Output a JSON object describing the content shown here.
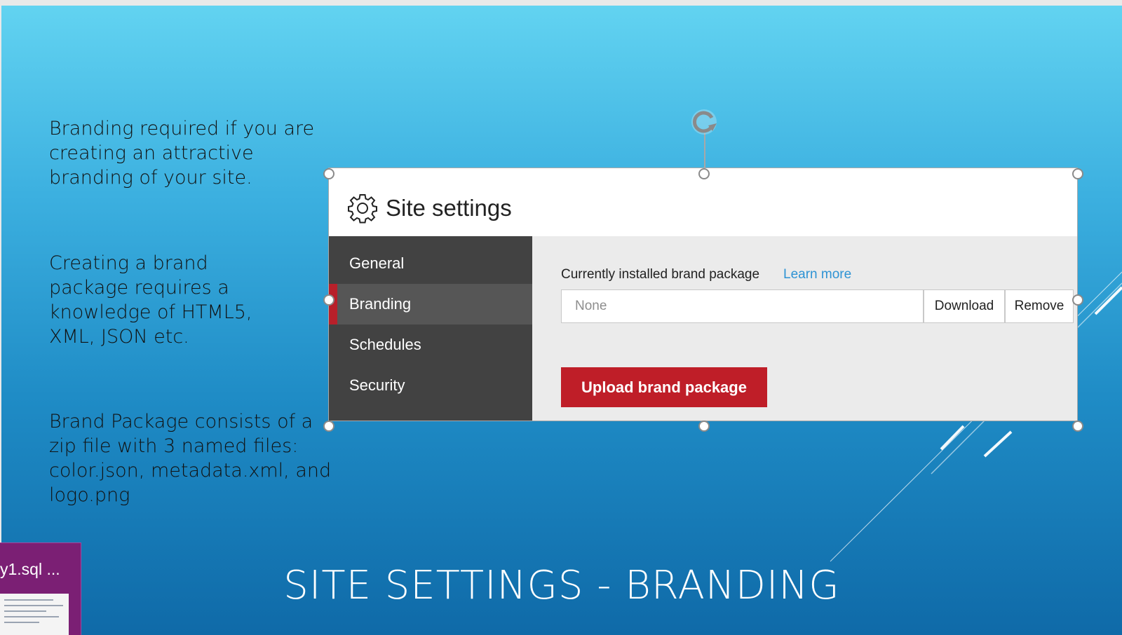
{
  "slide": {
    "title": "SITE SETTINGS - BRANDING",
    "bullets": [
      "Branding required if you are creating an attractive branding of your site.",
      "Creating a brand package requires a knowledge of HTML5, XML, JSON etc.",
      "Brand Package consists of a zip file with 3 named files: color.json, metadata.xml, and logo.png"
    ]
  },
  "panel": {
    "icon": "gear-icon",
    "title": "Site settings",
    "sidebar": [
      {
        "label": "General",
        "active": false
      },
      {
        "label": "Branding",
        "active": true
      },
      {
        "label": "Schedules",
        "active": false
      },
      {
        "label": "Security",
        "active": false
      }
    ],
    "content": {
      "installed_label": "Currently installed brand package",
      "learn_more": "Learn more",
      "package_value": "None",
      "download_label": "Download",
      "remove_label": "Remove",
      "upload_label": "Upload brand package"
    },
    "colors": {
      "accent": "#bf1e28",
      "link": "#2e93d4",
      "sidebar": "#424242"
    }
  },
  "taskbar": {
    "thumb_label": "y1.sql ..."
  }
}
